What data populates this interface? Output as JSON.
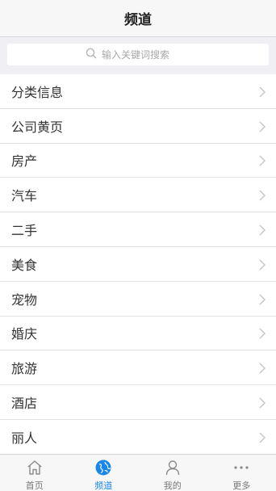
{
  "header": {
    "title": "频道"
  },
  "search": {
    "placeholder": "输入关键词搜索"
  },
  "list": {
    "items": [
      {
        "label": "分类信息"
      },
      {
        "label": "公司黄页"
      },
      {
        "label": "房产"
      },
      {
        "label": "汽车"
      },
      {
        "label": "二手"
      },
      {
        "label": "美食"
      },
      {
        "label": "宠物"
      },
      {
        "label": "婚庆"
      },
      {
        "label": "旅游"
      },
      {
        "label": "酒店"
      },
      {
        "label": "丽人"
      }
    ]
  },
  "tabbar": {
    "active_index": 1,
    "active_color": "#1a87e8",
    "tabs": [
      {
        "label": "首页",
        "icon": "home-icon"
      },
      {
        "label": "频道",
        "icon": "globe-icon"
      },
      {
        "label": "我的",
        "icon": "user-icon"
      },
      {
        "label": "更多",
        "icon": "more-icon"
      }
    ]
  }
}
